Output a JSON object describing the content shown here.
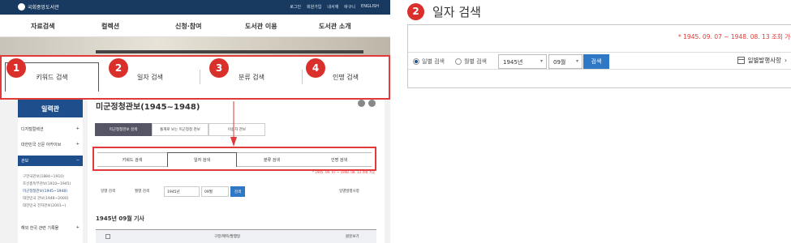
{
  "site": {
    "logo_text": "국회중앙도서관",
    "top_links": [
      "로그인",
      "회원가입",
      "내서재",
      "바구니",
      "ENGLISH"
    ],
    "nav": [
      "자료검색",
      "컬렉션",
      "신청·참여",
      "도서관 이용",
      "도서관 소개"
    ]
  },
  "big_tabs": [
    {
      "badge": "1",
      "label": "키워드 검색",
      "active": true
    },
    {
      "badge": "2",
      "label": "일자 검색",
      "active": false
    },
    {
      "badge": "3",
      "label": "분류 검색",
      "active": false
    },
    {
      "badge": "4",
      "label": "인명 검색",
      "active": false
    }
  ],
  "sidebar": {
    "head": "일력관",
    "items": [
      {
        "label": "디지털컬렉션",
        "mark": "+"
      },
      {
        "label": "대한민국 신문 아카이브",
        "mark": "+"
      },
      {
        "label": "관보",
        "mark": "−"
      },
      {
        "label": "해외 한국 관련 기록물",
        "mark": "+"
      }
    ],
    "sub_items": [
      "구한국관보(1884~1910)",
      "조선총독부관보(1910~1945)",
      "미군정청관보(1945~1948)",
      "대한민국 관보(1948~2000)",
      "대한민국 전자관보(2001~)"
    ]
  },
  "main": {
    "title": "미군정청관보(1945~1948)",
    "sub_tabs": [
      "미군정청관보 검색",
      "통계로 보는 미군정청 관보",
      "이용자 관보"
    ],
    "small_tabs": [
      "키워드 검색",
      "일자 검색",
      "분류 검색",
      "인명 검색"
    ],
    "small_note": "* 1945. 09. 07 ~ 1948. 08. 13 조회 가능",
    "month_title": "1945년 09월 기사",
    "table_headers": [
      "구분/제목/발행일",
      "원문보기"
    ]
  },
  "detail": {
    "badge": "2",
    "title": "일자 검색",
    "note": "* 1945. 09. 07 ~ 1948. 08. 13 조회 가능",
    "radio_day": "일별 검색",
    "radio_month": "월별 검색",
    "year_value": "1945년",
    "month_value": "09월",
    "search_button": "검색",
    "link_label": "일별발행사항"
  }
}
